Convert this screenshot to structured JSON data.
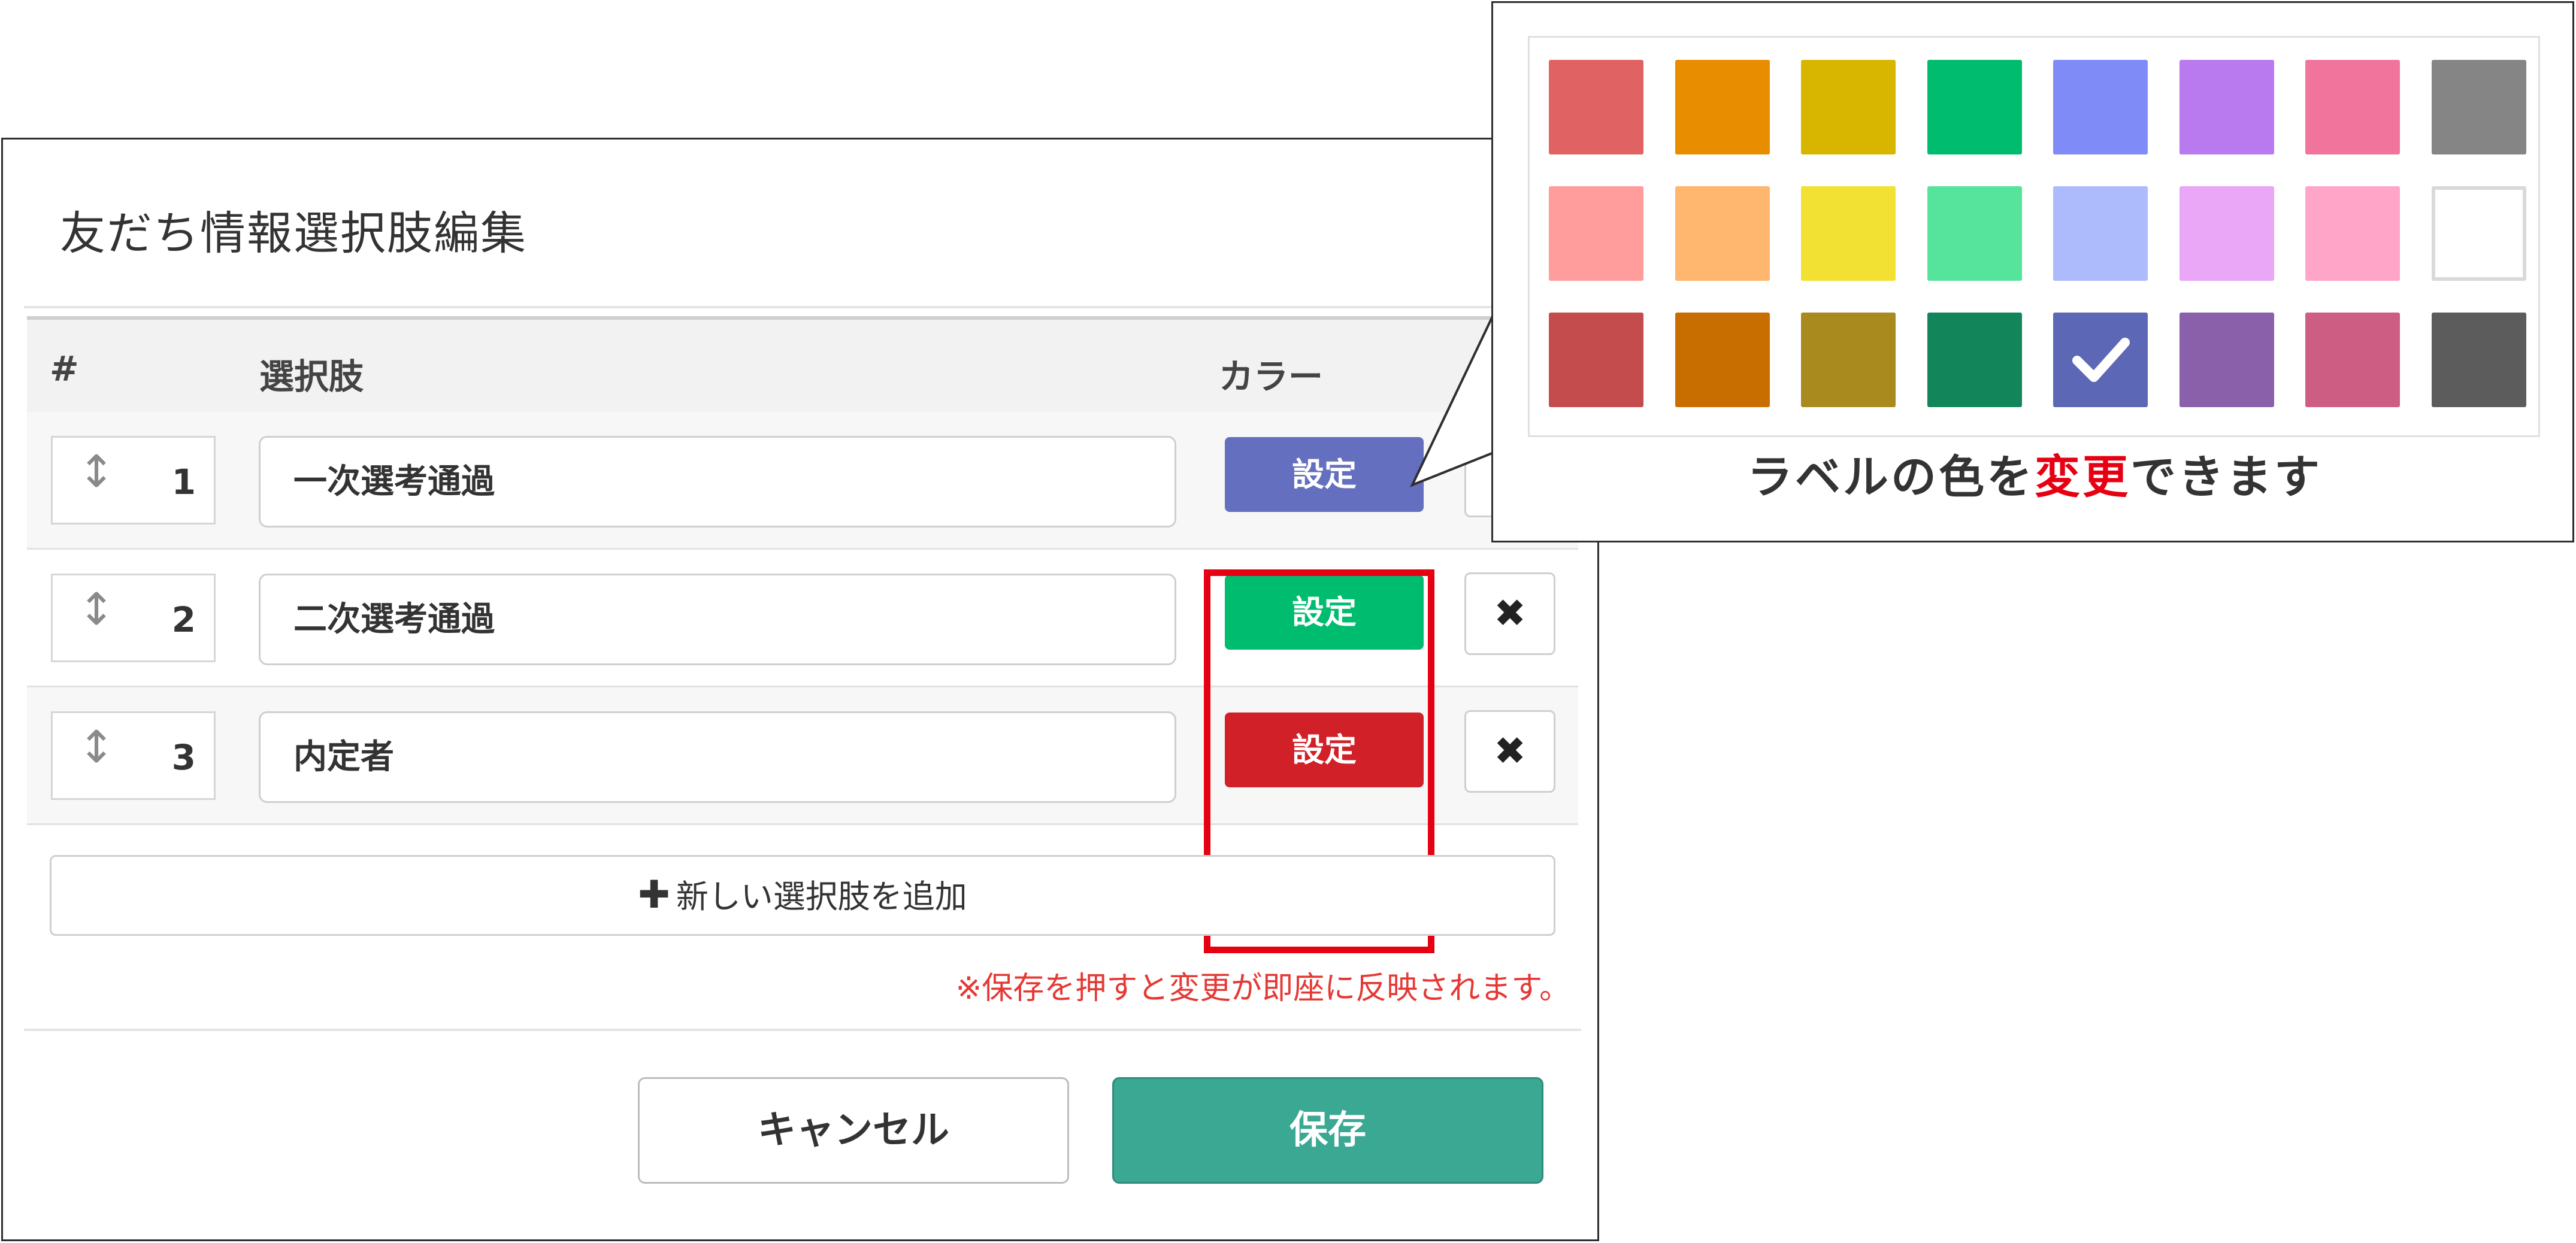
{
  "modal": {
    "title": "友だち情報選択肢編集",
    "columns": {
      "index": "#",
      "option": "選択肢",
      "color": "カラー"
    },
    "rows": [
      {
        "number": "1",
        "value": "一次選考通過",
        "set_label": "設定",
        "color": "#646fbf",
        "delete_icon": "✖"
      },
      {
        "number": "2",
        "value": "二次選考通過",
        "set_label": "設定",
        "color": "#00bc6e",
        "delete_icon": "✖"
      },
      {
        "number": "3",
        "value": "内定者",
        "set_label": "設定",
        "color": "#d12027",
        "delete_icon": "✖"
      }
    ],
    "add_button": {
      "icon": "✚",
      "label": "新しい選択肢を追加"
    },
    "notice": "※保存を押すと変更が即座に反映されます。",
    "cancel_label": "キャンセル",
    "save_label": "保存"
  },
  "callout": {
    "caption_before": "ラベルの色を",
    "caption_emphasis": "変更",
    "caption_after": "できます",
    "selected_swatch": "row3-col5",
    "swatches": [
      [
        "#e06262",
        "#e88c00",
        "#d8b600",
        "#00bc6e",
        "#7f8cf7",
        "#b97aef",
        "#f0749c",
        "#858585"
      ],
      [
        "#ff9c9c",
        "#ffb66f",
        "#f2e132",
        "#56e39c",
        "#adbafc",
        "#eaa6f7",
        "#ffa6c8",
        "#ffffff"
      ],
      [
        "#c44c4c",
        "#c86e00",
        "#a98a1f",
        "#12855a",
        "#5c67b5",
        "#8960a9",
        "#cd5d82",
        "#5c5c5c"
      ]
    ]
  },
  "colors": {
    "highlight_border": "#e60012",
    "save_button": "#3ba894",
    "notice_text": "#e53935"
  }
}
